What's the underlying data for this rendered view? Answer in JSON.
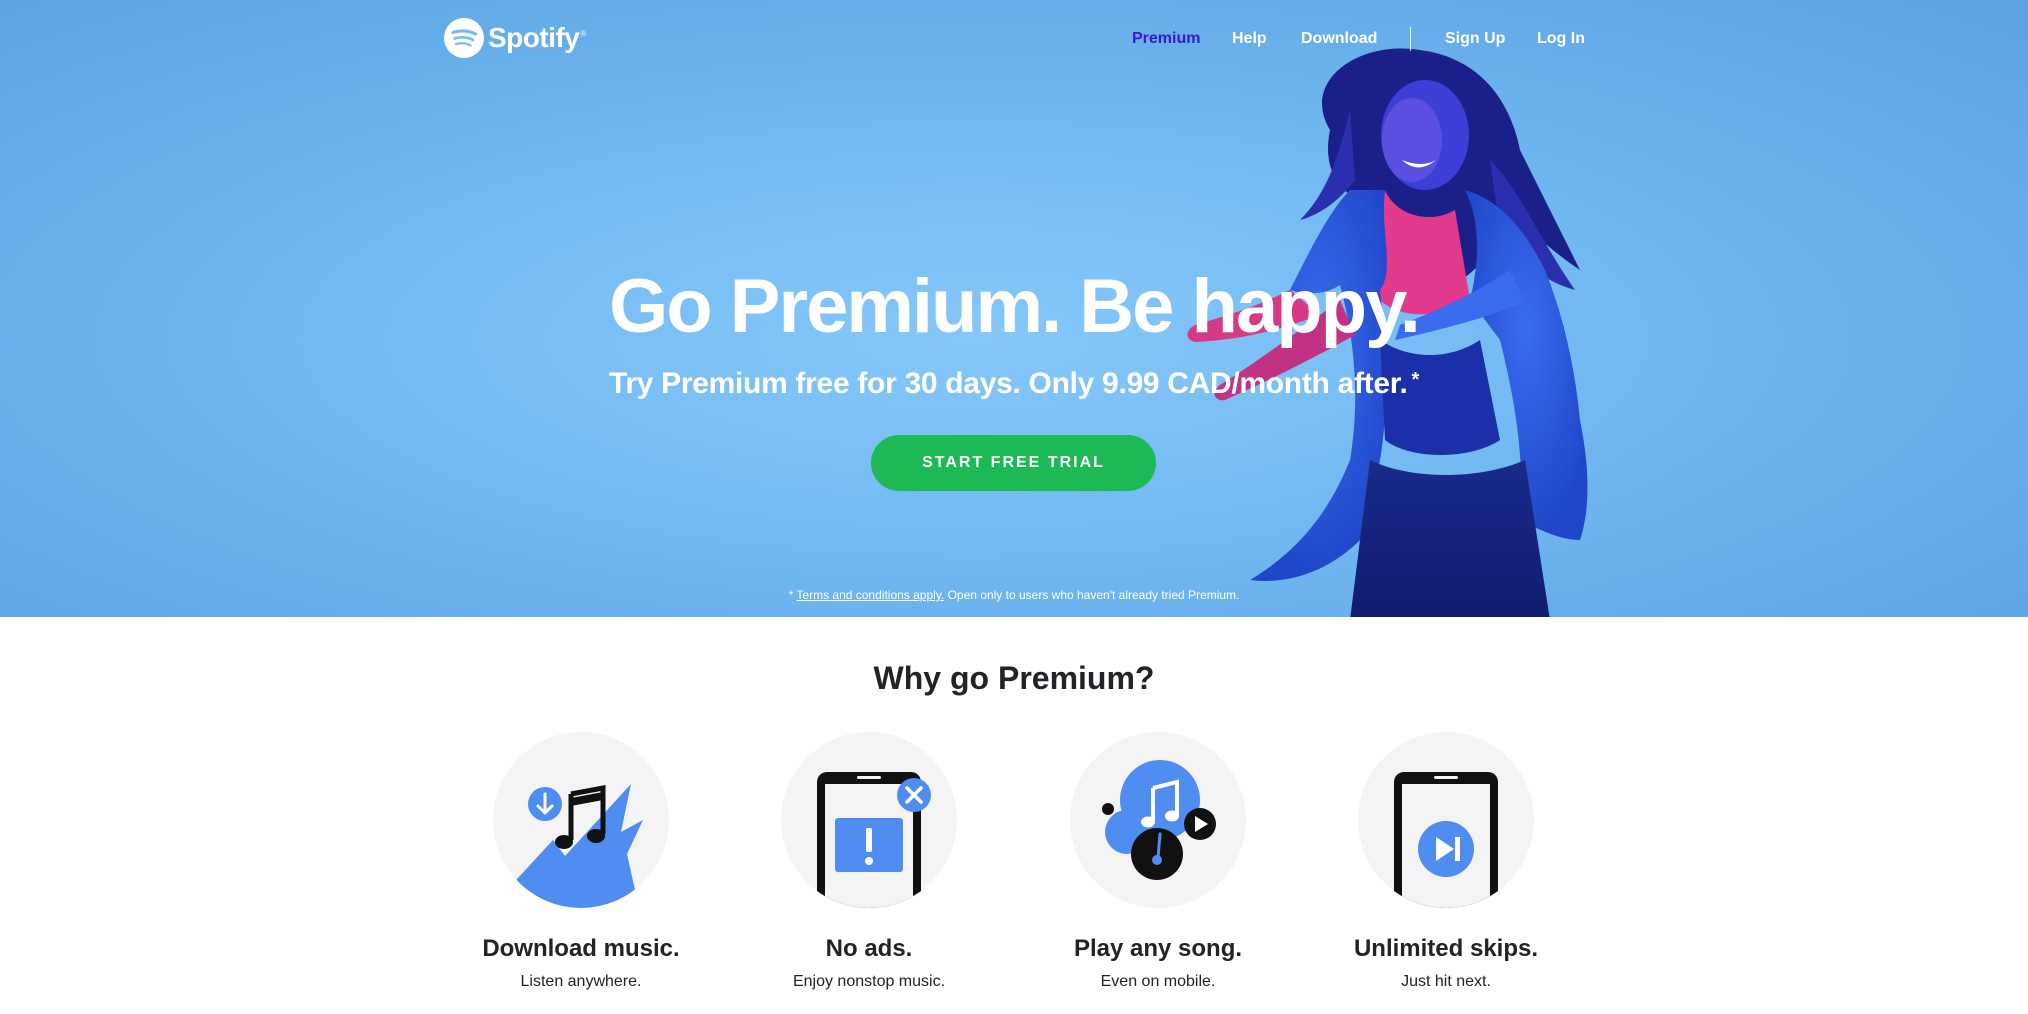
{
  "brand": {
    "name": "Spotify",
    "logo_icon": "spotify-logo-icon"
  },
  "nav": {
    "premium": "Premium",
    "help": "Help",
    "download": "Download",
    "signup": "Sign Up",
    "login": "Log In"
  },
  "hero": {
    "headline": "Go Premium. Be happy.",
    "subline": "Try Premium free for 30 days. Only 9.99 CAD/month after.",
    "subline_mark": "*",
    "cta": "START FREE TRIAL",
    "terms_mark": "*",
    "terms_link": "Terms and conditions apply.",
    "terms_text": " Open only to users who haven't already tried Premium."
  },
  "why": {
    "title": "Why go Premium?",
    "features": [
      {
        "title": "Download music.",
        "desc": "Listen anywhere.",
        "icon": "download-music-icon"
      },
      {
        "title": "No ads.",
        "desc": "Enjoy nonstop music.",
        "icon": "no-ads-icon"
      },
      {
        "title": "Play any song.",
        "desc": "Even on mobile.",
        "icon": "play-any-song-icon"
      },
      {
        "title": "Unlimited skips.",
        "desc": "Just hit next.",
        "icon": "unlimited-skips-icon"
      }
    ]
  },
  "colors": {
    "hero_bg": "#76bcf4",
    "cta_green": "#1db954",
    "nav_active": "#3a17d6",
    "icon_blue": "#4f8ef0",
    "icon_circle": "#f4f4f6",
    "text_dark": "#222326"
  }
}
